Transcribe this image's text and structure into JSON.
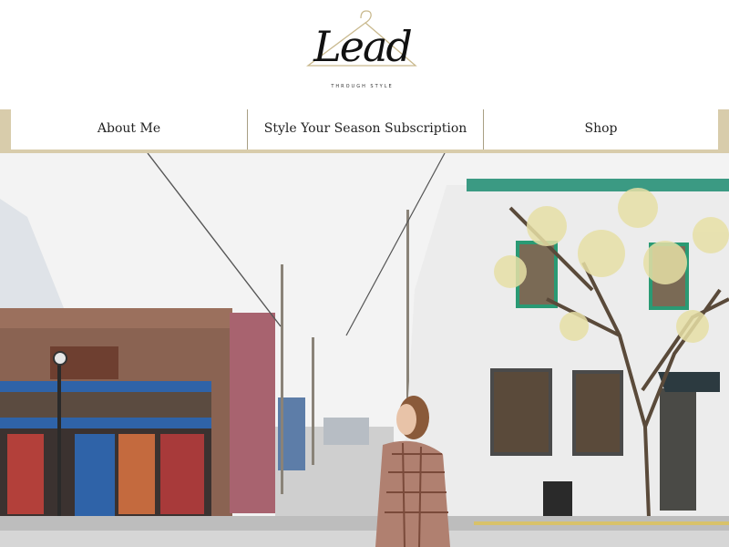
{
  "logo": {
    "script_text": "Lead",
    "tagline": "THROUGH STYLE"
  },
  "nav": {
    "items": [
      {
        "label": "About Me"
      },
      {
        "label": "Style Your Season Subscription"
      },
      {
        "label": "Shop"
      }
    ]
  },
  "hero": {
    "image_subject": "street-scene-woman-walking-photo"
  },
  "colors": {
    "nav_accent": "#d8ccab",
    "header_bg": "#ffffff",
    "text": "#222222"
  }
}
